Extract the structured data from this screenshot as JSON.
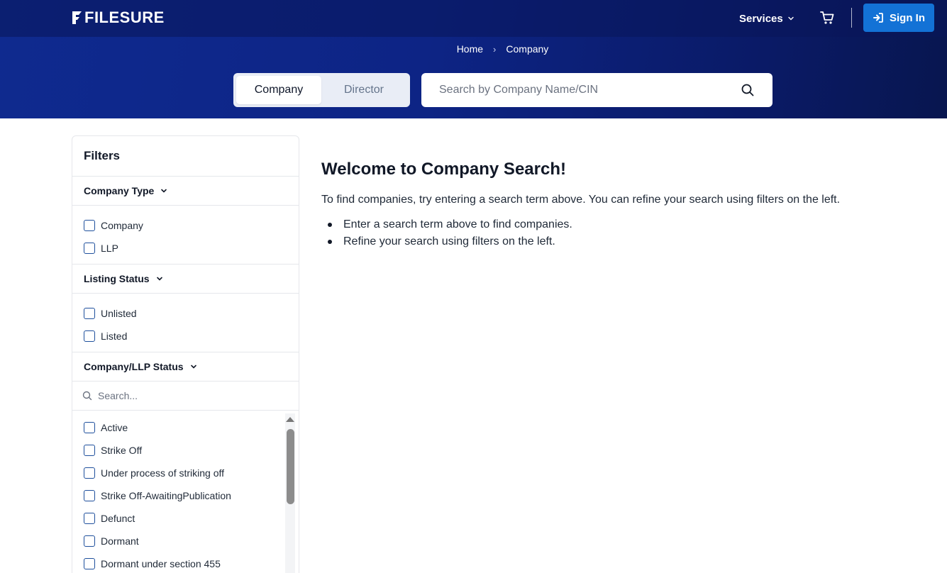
{
  "header": {
    "logo_text": "FILESURE",
    "services_label": "Services",
    "signin_label": "Sign In",
    "cart_icon": "cart-icon"
  },
  "breadcrumb": {
    "items": [
      "Home",
      "Company"
    ]
  },
  "search": {
    "tabs": [
      "Company",
      "Director"
    ],
    "active_tab": "Company",
    "placeholder": "Search by Company Name/CIN"
  },
  "filters": {
    "title": "Filters",
    "company_type": {
      "label": "Company Type",
      "options": [
        "Company",
        "LLP"
      ]
    },
    "listing_status": {
      "label": "Listing Status",
      "options": [
        "Unlisted",
        "Listed"
      ]
    },
    "company_status": {
      "label": "Company/LLP Status",
      "search_placeholder": "Search...",
      "options": [
        "Active",
        "Strike Off",
        "Under process of striking off",
        "Strike Off-AwaitingPublication",
        "Defunct",
        "Dormant",
        "Dormant under section 455"
      ]
    }
  },
  "main": {
    "title": "Welcome to Company Search!",
    "intro": "To find companies, try entering a search term above. You can refine your search using filters on the left.",
    "tips": [
      "Enter a search term above to find companies.",
      "Refine your search using filters on the left."
    ]
  },
  "colors": {
    "header_blue": "#0d2485",
    "signin_blue": "#1372d6",
    "checkbox_border": "#1e4f9c"
  }
}
